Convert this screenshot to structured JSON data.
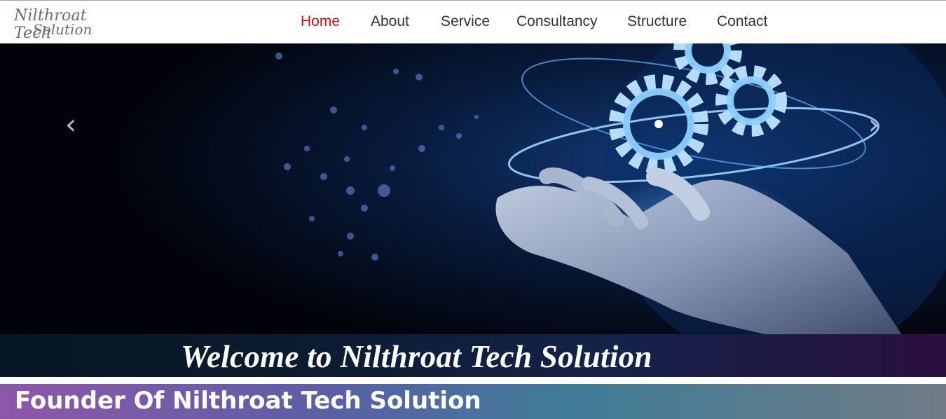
{
  "header": {
    "logo": {
      "line1": "Nilthroat Tech",
      "line2": "Solution"
    },
    "nav": [
      {
        "label": "Home",
        "active": true
      },
      {
        "label": "About",
        "active": false
      },
      {
        "label": "Service",
        "active": false
      },
      {
        "label": "Consultancy",
        "active": false
      },
      {
        "label": "Structure",
        "active": false
      },
      {
        "label": "Contact",
        "active": false
      }
    ]
  },
  "hero": {
    "prev_icon": "chevron-left-icon",
    "next_icon": "chevron-right-icon",
    "prev_glyph": "‹",
    "next_glyph": "›",
    "caption": "Welcome to Nilthroat Tech Solution"
  },
  "founder": {
    "title": "Founder Of Nilthroat Tech Solution"
  },
  "colors": {
    "active_nav": "#d10f12",
    "nav_text": "#333333"
  }
}
